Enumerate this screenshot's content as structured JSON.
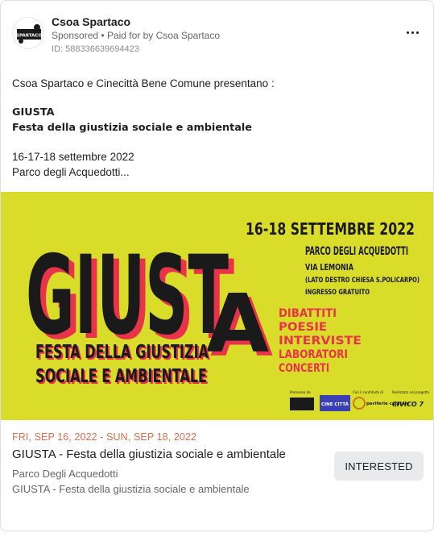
{
  "header": {
    "page_name": "Csoa Spartaco",
    "sponsored_text": "Sponsored",
    "paid_for_prefix": "Paid for by",
    "paid_for_name": "Csoa Spartaco",
    "ad_id": "ID: 588336639694423",
    "avatar_text": "SPARTACO"
  },
  "body": {
    "intro": "Csoa Spartaco e Cinecittà Bene Comune presentano :",
    "title": "GIUSTA",
    "subtitle": "Festa della giustizia sociale e ambientale",
    "dates": "16-17-18 settembre 2022",
    "location": "Parco degli Acquedotti..."
  },
  "poster": {
    "main_word": "GIUST",
    "main_letter": "A",
    "festa_line1": "FESTA DELLA GIUSTIZIA",
    "festa_line2": "SOCIALE E AMBIENTALE",
    "dates": "16-18 SETTEMBRE 2022",
    "venue": "PARCO DEGLI ACQUEDOTTI",
    "street": "VIA LEMONIA",
    "detail": "(LATO DESTRO CHIESA S.POLICARPO)",
    "entry": "INGRESSO GRATUITO",
    "activities": [
      "DIBATTITI",
      "POESIE",
      "INTERVISTE",
      "LABORATORI",
      "CONCERTI"
    ],
    "credits": [
      "Promosso da",
      "Con il contributo di",
      "Realizzato nel progetto"
    ],
    "logos": [
      "CINE CITTÀ",
      "periferie capitale",
      "CIVICO 7"
    ],
    "colors": {
      "background": "#d9dd2a",
      "ink": "#1a1a1a",
      "accent": "#e8334a"
    }
  },
  "event": {
    "date_range": "FRI, SEP 16, 2022 - SUN, SEP 18, 2022",
    "title": "GIUSTA - Festa della giustizia sociale e ambientale",
    "location": "Parco Degli Acquedotti",
    "description": "GIUSTA - Festa della giustizia sociale e ambientale",
    "interested_label": "INTERESTED"
  },
  "icons": {
    "more": "more-horizontal-icon"
  }
}
